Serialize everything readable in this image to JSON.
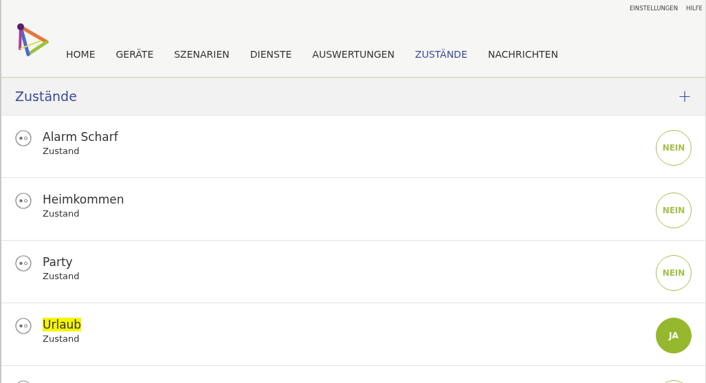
{
  "top_links": [
    "EINSTELLUNGEN",
    "HILFE"
  ],
  "nav": [
    {
      "label": "HOME",
      "selected": false
    },
    {
      "label": "GERÄTE",
      "selected": false
    },
    {
      "label": "SZENARIEN",
      "selected": false
    },
    {
      "label": "DIENSTE",
      "selected": false
    },
    {
      "label": "AUSWERTUNGEN",
      "selected": false
    },
    {
      "label": "ZUSTÄNDE",
      "selected": true
    },
    {
      "label": "NACHRICHTEN",
      "selected": false
    }
  ],
  "page_title": "Zustände",
  "add_button": "+",
  "rows": [
    {
      "name": "Alarm Scharf",
      "type": "Zustand",
      "on": false,
      "state": "NEIN",
      "highlighted": false
    },
    {
      "name": "Heimkommen",
      "type": "Zustand",
      "on": false,
      "state": "NEIN",
      "highlighted": false
    },
    {
      "name": "Party",
      "type": "Zustand",
      "on": false,
      "state": "NEIN",
      "highlighted": false
    },
    {
      "name": "Urlaub",
      "type": "Zustand",
      "on": true,
      "state": "JA",
      "highlighted": true
    },
    {
      "on": false
    }
  ]
}
